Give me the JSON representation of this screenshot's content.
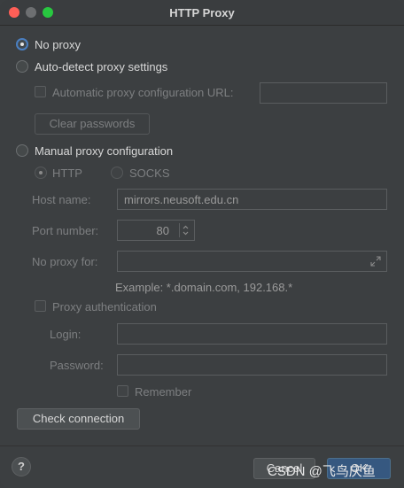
{
  "window": {
    "title": "HTTP Proxy"
  },
  "options": {
    "no_proxy": "No proxy",
    "auto_detect": "Auto-detect proxy settings",
    "auto_config_url": "Automatic proxy configuration URL:",
    "clear_passwords": "Clear passwords",
    "manual": "Manual proxy configuration",
    "http": "HTTP",
    "socks": "SOCKS"
  },
  "fields": {
    "host_label": "Host name:",
    "host_value": "mirrors.neusoft.edu.cn",
    "port_label": "Port number:",
    "port_value": "80",
    "noproxy_label": "No proxy for:",
    "example": "Example: *.domain.com, 192.168.*",
    "proxy_auth": "Proxy authentication",
    "login_label": "Login:",
    "password_label": "Password:",
    "remember": "Remember"
  },
  "buttons": {
    "check_connection": "Check connection",
    "help": "?",
    "cancel": "Cancel",
    "ok": "OK"
  },
  "watermark": "CSDN @飞鸟庆鱼"
}
